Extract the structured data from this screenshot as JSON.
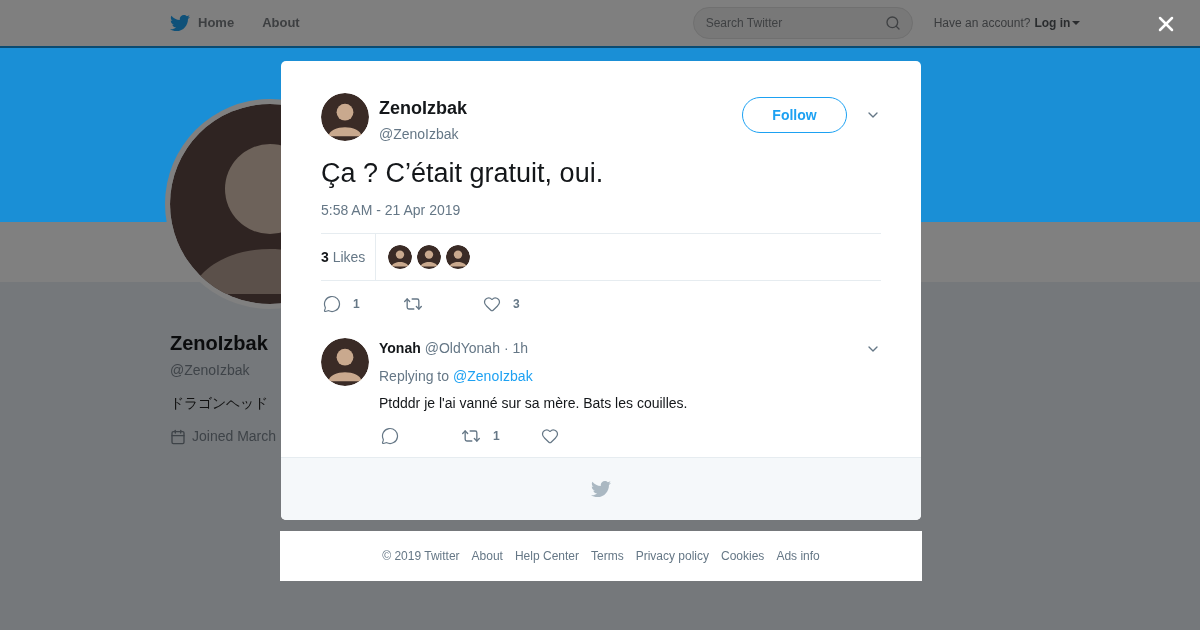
{
  "nav": {
    "links": [
      {
        "label": "Home",
        "kind": "home"
      },
      {
        "label": "About",
        "kind": "plain"
      }
    ],
    "search": {
      "placeholder": "Search Twitter"
    },
    "account_prompt": "Have an account?",
    "login": "Log in"
  },
  "profile": {
    "name": "ZenoIzbak",
    "handle": "@ZenoIzbak",
    "bio": "ドラゴンヘッド",
    "joined": "Joined March"
  },
  "tweet": {
    "author": "ZenoIzbak",
    "handle": "@ZenoIzbak",
    "follow": "Follow",
    "text": "Ça ? C’était gratuit, oui.",
    "timestamp": "5:58 AM - 21 Apr 2019",
    "likes_count": "3",
    "likes_label": "Likes",
    "actions": [
      {
        "kind": "reply",
        "count": "1"
      },
      {
        "kind": "retweet"
      },
      {
        "kind": "like",
        "count": "3"
      }
    ]
  },
  "reply": {
    "name": "Yonah",
    "handle": "@OldYonah",
    "time": "· 1h",
    "replying_label": "Replying to",
    "replying_to": "@ZenoIzbak",
    "text": "Ptdddr je l'ai vanné sur sa mère. Bats les couilles.",
    "actions": [
      {
        "kind": "reply"
      },
      {
        "kind": "retweet",
        "count": "1"
      },
      {
        "kind": "like"
      }
    ]
  },
  "footer": [
    "© 2019 Twitter",
    "About",
    "Help Center",
    "Terms",
    "Privacy policy",
    "Cookies",
    "Ads info"
  ]
}
